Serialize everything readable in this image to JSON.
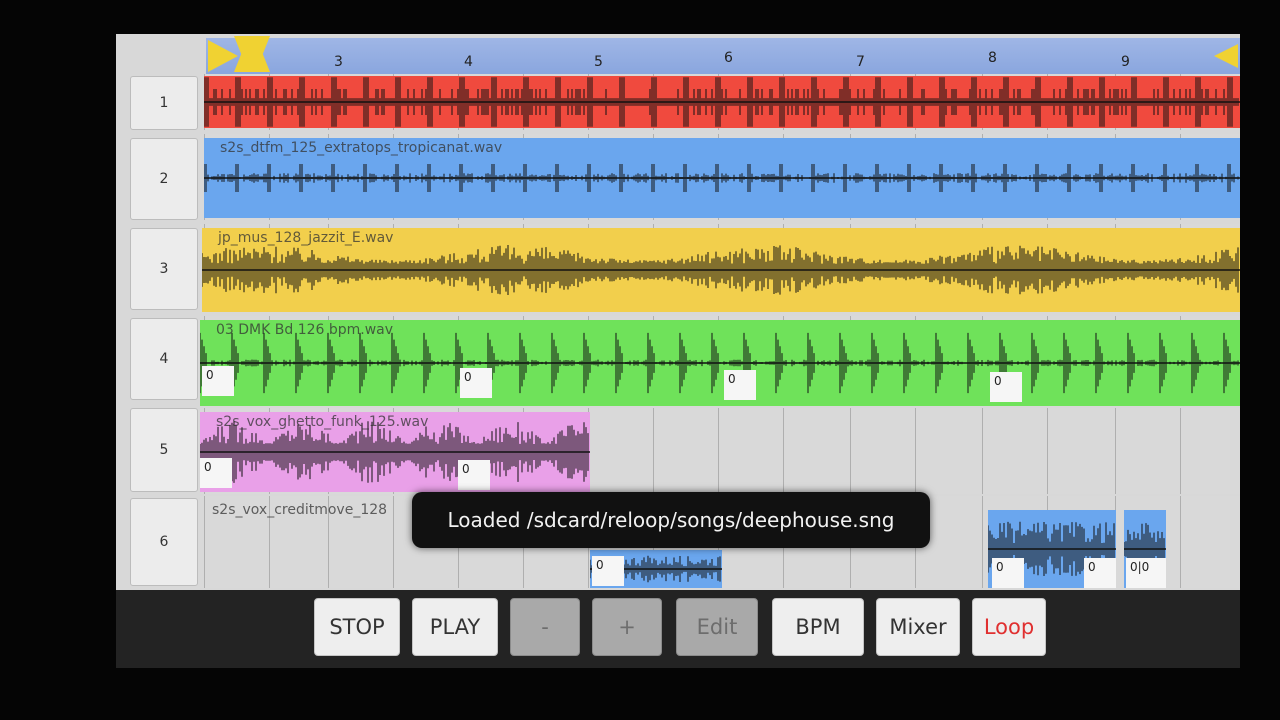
{
  "timeline": {
    "bar_numbers": [
      "3",
      "4",
      "5",
      "6",
      "7",
      "8",
      "9"
    ]
  },
  "tracks": [
    {
      "number": "1",
      "clip_name": "",
      "color": "#f04a3e"
    },
    {
      "number": "2",
      "clip_name": "s2s_dtfm_125_extratops_tropicanat.wav",
      "color": "#6aa6ee"
    },
    {
      "number": "3",
      "clip_name": "jp_mus_128_jazzit_E.wav",
      "color": "#f2cf4c"
    },
    {
      "number": "4",
      "clip_name": "03 DMK Bd 126 bpm.wav",
      "color": "#6fe25a"
    },
    {
      "number": "5",
      "clip_name": "s2s_vox_ghetto_funk_125.wav",
      "color": "#e9a0e8"
    },
    {
      "number": "6",
      "clip_name": "s2s_vox_creditmove_128",
      "color": "#6aa6ee"
    }
  ],
  "markers": {
    "zero": "0",
    "double": "0|0"
  },
  "toast": {
    "message": "Loaded /sdcard/reloop/songs/deephouse.sng"
  },
  "toolbar": {
    "stop": "STOP",
    "play": "PLAY",
    "minus": "-",
    "plus": "+",
    "edit": "Edit",
    "bpm": "BPM",
    "mixer": "Mixer",
    "loop": "Loop"
  }
}
